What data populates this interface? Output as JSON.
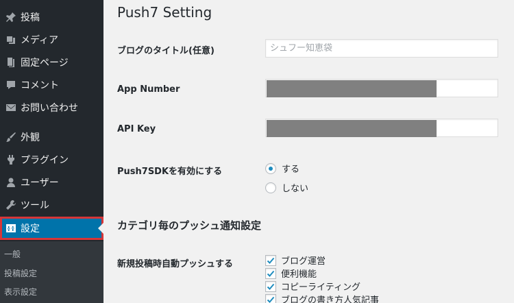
{
  "sidebar": {
    "items": [
      {
        "label": "投稿",
        "icon": "pushpin-icon"
      },
      {
        "label": "メディア",
        "icon": "media-icon"
      },
      {
        "label": "固定ページ",
        "icon": "page-icon"
      },
      {
        "label": "コメント",
        "icon": "comment-icon"
      },
      {
        "label": "お問い合わせ",
        "icon": "mail-icon"
      },
      {
        "label": "外観",
        "icon": "brush-icon"
      },
      {
        "label": "プラグイン",
        "icon": "plugin-icon"
      },
      {
        "label": "ユーザー",
        "icon": "user-icon"
      },
      {
        "label": "ツール",
        "icon": "wrench-icon"
      },
      {
        "label": "設定",
        "icon": "settings-icon"
      }
    ],
    "submenu": [
      "一般",
      "投稿設定",
      "表示設定"
    ]
  },
  "main": {
    "title": "Push7 Setting",
    "fields": {
      "blog_title": {
        "label": "ブログのタイトル(任意)",
        "placeholder": "シュフー知恵袋"
      },
      "app_number": {
        "label": "App Number",
        "redacted_fraction": 0.73
      },
      "api_key": {
        "label": "API Key",
        "redacted_fraction": 0.73
      }
    },
    "sdk": {
      "label": "Push7SDKを有効にする",
      "options": [
        "する",
        "しない"
      ],
      "selected": "する"
    },
    "category_section": {
      "title": "カテゴリ毎のプッシュ通知設定",
      "auto_label": "新規投稿時自動プッシュする",
      "categories": [
        {
          "label": "ブログ運営",
          "checked": true
        },
        {
          "label": "便利機能",
          "checked": true
        },
        {
          "label": "コピーライティング",
          "checked": true
        },
        {
          "label": "ブログの書き方人気記事",
          "checked": true
        }
      ]
    }
  },
  "colors": {
    "sidebar_bg": "#23282d",
    "active_bg": "#0073aa",
    "highlight_border": "#d63638",
    "check": "#1e8cbe"
  }
}
